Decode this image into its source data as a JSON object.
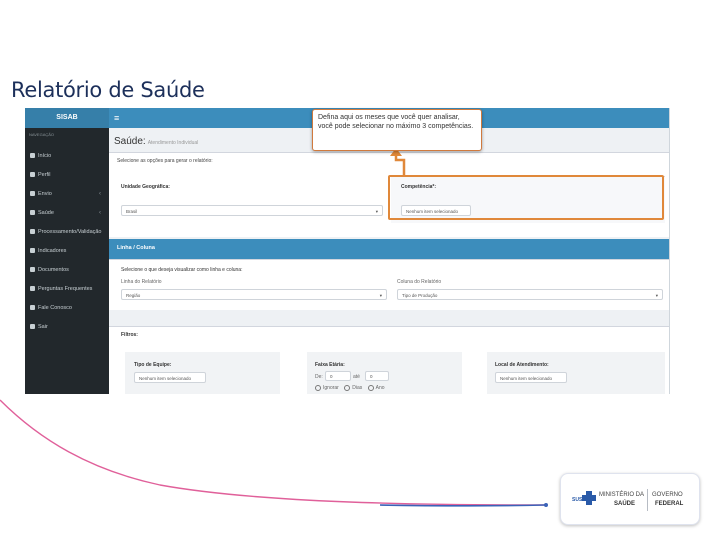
{
  "slide": {
    "title": "Relatório de Saúde",
    "callout_text": "Defina aqui os meses que você quer analisar, você pode selecionar no máximo 3 competências."
  },
  "app": {
    "brand": "SISAB",
    "sidebar_header": "NAVEGAÇÃO",
    "nav_items": [
      {
        "label": "Início",
        "icon": "home-icon",
        "has_chevron": false
      },
      {
        "label": "Perfil",
        "icon": "user-icon",
        "has_chevron": false
      },
      {
        "label": "Envio",
        "icon": "upload-icon",
        "has_chevron": true
      },
      {
        "label": "Saúde",
        "icon": "filter-icon",
        "has_chevron": true
      },
      {
        "label": "Processamento/Validação",
        "icon": "list-icon",
        "has_chevron": false
      },
      {
        "label": "Indicadores",
        "icon": "info-icon",
        "has_chevron": false
      },
      {
        "label": "Documentos",
        "icon": "document-icon",
        "has_chevron": false
      },
      {
        "label": "Perguntas Frequentes",
        "icon": "faq-icon",
        "has_chevron": false
      },
      {
        "label": "Fale Conosco",
        "icon": "contact-icon",
        "has_chevron": false
      },
      {
        "label": "Sair",
        "icon": "power-icon",
        "has_chevron": false
      }
    ],
    "page_title": "Saúde:",
    "page_subtitle": "Atendimento Individual",
    "intro_text": "Selecione as opções para gerar o relatório:",
    "unidade_label": "Unidade Geográfica:",
    "unidade_value": "Brasil",
    "competencia_label": "Competência*:",
    "competencia_value": "Nenhum item selecionado",
    "linha_coluna_title": "Linha / Coluna",
    "linha_coluna_intro": "Selecione o que deseja visualizar como linha e coluna:",
    "linha_label": "Linha do Relatório",
    "linha_value": "Região",
    "coluna_label": "Coluna do Relatório",
    "coluna_value": "Tipo de Produção",
    "filtros_label": "Filtros:",
    "tipo_equipe_label": "Tipo de Equipe:",
    "tipo_equipe_value": "Nenhum item selecionado",
    "faixa_etaria_label": "Faixa Etária:",
    "faixa_de_label": "De:",
    "faixa_de_value": "0",
    "faixa_ate_label": "até",
    "faixa_ate_value": "0",
    "faixa_options": [
      "Ignorar",
      "Dias",
      "Ano"
    ],
    "local_atendimento_label": "Local de Atendimento:",
    "local_atendimento_value": "Nenhum item selecionado"
  },
  "footer": {
    "sus": "SUS",
    "ministerio_line1": "MINISTÉRIO DA",
    "ministerio_line2": "SAÚDE",
    "governo_line1": "GOVERNO",
    "governo_line2": "FEDERAL"
  },
  "colors": {
    "sidebar": "#22282c",
    "topbar": "#3c8dbc",
    "highlight": "#e0883a",
    "title": "#1c2f5a"
  }
}
